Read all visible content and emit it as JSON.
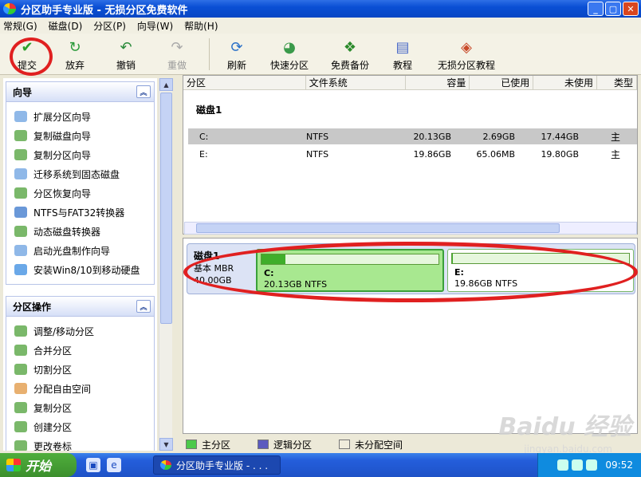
{
  "window": {
    "title": "分区助手专业版 - 无损分区免费软件"
  },
  "menu": [
    "常规(G)",
    "磁盘(D)",
    "分区(P)",
    "向导(W)",
    "帮助(H)"
  ],
  "toolbar": [
    {
      "label": "提交",
      "icon": "check-icon",
      "disabled": false
    },
    {
      "label": "放弃",
      "icon": "discard-icon",
      "disabled": false
    },
    {
      "label": "撤销",
      "icon": "undo-icon",
      "disabled": false
    },
    {
      "label": "重做",
      "icon": "redo-icon",
      "disabled": true
    },
    {
      "label": "刷新",
      "icon": "refresh-icon",
      "disabled": false
    },
    {
      "label": "快速分区",
      "icon": "quick-partition-icon",
      "disabled": false
    },
    {
      "label": "免费备份",
      "icon": "backup-icon",
      "disabled": false
    },
    {
      "label": "教程",
      "icon": "tutorial-icon",
      "disabled": false
    },
    {
      "label": "无损分区教程",
      "icon": "lossless-tutorial-icon",
      "disabled": false
    }
  ],
  "wizard": {
    "title": "向导",
    "items": [
      "扩展分区向导",
      "复制磁盘向导",
      "复制分区向导",
      "迁移系统到固态磁盘",
      "分区恢复向导",
      "NTFS与FAT32转换器",
      "动态磁盘转换器",
      "启动光盘制作向导",
      "安装Win8/10到移动硬盘"
    ]
  },
  "ops": {
    "title": "分区操作",
    "items": [
      "调整/移动分区",
      "合并分区",
      "切割分区",
      "分配自由空间",
      "复制分区",
      "创建分区",
      "更改卷标"
    ]
  },
  "table": {
    "headers": [
      "分区",
      "文件系统",
      "容量",
      "已使用",
      "未使用",
      "类型"
    ],
    "disk_label": "磁盘1",
    "rows": [
      {
        "part": "C:",
        "fs": "NTFS",
        "cap": "20.13GB",
        "used": "2.69GB",
        "free": "17.44GB",
        "type": "主"
      },
      {
        "part": "E:",
        "fs": "NTFS",
        "cap": "19.86GB",
        "used": "65.06MB",
        "free": "19.80GB",
        "type": "主"
      }
    ]
  },
  "diskmap": {
    "name": "磁盘1",
    "kind": "基本 MBR",
    "size": "40.00GB",
    "partitions": [
      {
        "label": "C:",
        "desc": "20.13GB NTFS",
        "used_fraction": 0.134
      },
      {
        "label": "E:",
        "desc": "19.86GB NTFS",
        "used_fraction": 0.003
      }
    ]
  },
  "legend": [
    "主分区",
    "逻辑分区",
    "未分配空间"
  ],
  "legend_colors": [
    "#4cc94a",
    "#5b5bbf",
    "#f0ecdc"
  ],
  "taskbar": {
    "start": "开始",
    "task": "分区助手专业版 - . . .",
    "time": "09:52"
  },
  "watermark": {
    "brand": "Baidu 经验",
    "site": "jingyan.baidu.com"
  }
}
